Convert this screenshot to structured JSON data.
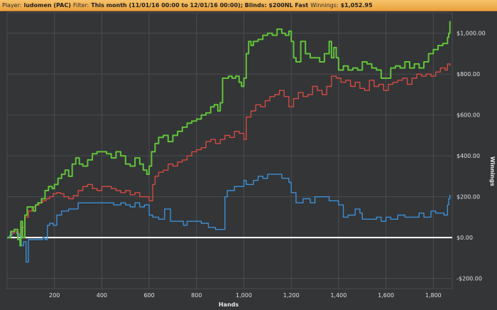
{
  "header": {
    "player_label": "Player:",
    "player_value": "ludomen (PAC)",
    "filter_label": "Filter:",
    "filter_value": "This month (11/01/16 00:00 to 12/01/16 00:00); Blinds: $200NL Fast",
    "winnings_label": "Winnings:",
    "winnings_value": "$1,052.95"
  },
  "colors": {
    "background": "#333537",
    "grid": "#4a4d50",
    "zero_line": "#ffffff",
    "header": "#f0ad4e"
  },
  "chart_data": {
    "type": "line",
    "xlabel": "Hands",
    "ylabel": "Winnings",
    "xlim": [
      0,
      1880
    ],
    "ylim": [
      -250,
      1100
    ],
    "xticks": [
      200,
      400,
      600,
      800,
      1000,
      1200,
      1400,
      1600,
      1800
    ],
    "xtick_labels": [
      "200",
      "400",
      "600",
      "800",
      "1,000",
      "1,200",
      "1,400",
      "1,600",
      "1,800"
    ],
    "yticks": [
      -200,
      0,
      200,
      400,
      600,
      800,
      1000
    ],
    "ytick_labels": [
      "-$200.00",
      "$0.00",
      "$200.00",
      "$400.00",
      "$600.00",
      "$800.00",
      "$1,000.00"
    ],
    "grid": true,
    "series": [
      {
        "color": "#62c33a",
        "x": [
          0,
          15,
          30,
          45,
          55,
          58,
          65,
          75,
          85,
          100,
          110,
          120,
          130,
          145,
          160,
          175,
          190,
          200,
          215,
          230,
          245,
          260,
          275,
          290,
          305,
          320,
          340,
          360,
          380,
          400,
          420,
          440,
          460,
          480,
          500,
          520,
          540,
          560,
          575,
          590,
          600,
          610,
          625,
          640,
          660,
          680,
          700,
          720,
          740,
          760,
          780,
          800,
          820,
          840,
          860,
          875,
          890,
          900,
          910,
          920,
          935,
          950,
          965,
          980,
          990,
          1000,
          1010,
          1020,
          1030,
          1040,
          1060,
          1080,
          1100,
          1120,
          1140,
          1160,
          1175,
          1190,
          1200,
          1210,
          1220,
          1240,
          1260,
          1280,
          1300,
          1320,
          1340,
          1350,
          1360,
          1370,
          1380,
          1390,
          1400,
          1420,
          1440,
          1460,
          1480,
          1500,
          1520,
          1540,
          1560,
          1580,
          1600,
          1620,
          1640,
          1660,
          1680,
          1700,
          1720,
          1740,
          1760,
          1780,
          1800,
          1820,
          1840,
          1850,
          1860,
          1865,
          1870
        ],
        "y": [
          0,
          30,
          40,
          -10,
          -40,
          80,
          0,
          110,
          150,
          150,
          130,
          160,
          170,
          190,
          230,
          250,
          240,
          260,
          290,
          310,
          330,
          300,
          360,
          390,
          360,
          350,
          380,
          410,
          420,
          420,
          410,
          390,
          420,
          400,
          360,
          350,
          390,
          360,
          330,
          310,
          350,
          420,
          460,
          490,
          500,
          470,
          500,
          520,
          540,
          560,
          570,
          580,
          600,
          610,
          640,
          650,
          620,
          660,
          780,
          780,
          790,
          780,
          790,
          760,
          740,
          780,
          900,
          960,
          940,
          960,
          970,
          990,
          1000,
          990,
          1020,
          1000,
          990,
          1010,
          960,
          880,
          860,
          960,
          900,
          880,
          880,
          860,
          900,
          900,
          960,
          880,
          930,
          880,
          820,
          840,
          820,
          830,
          820,
          860,
          850,
          830,
          820,
          780,
          780,
          830,
          840,
          830,
          860,
          830,
          850,
          830,
          860,
          900,
          920,
          940,
          950,
          950,
          980,
          1000,
          1060
        ]
      },
      {
        "color": "#d54a40",
        "x": [
          0,
          15,
          30,
          45,
          60,
          75,
          90,
          105,
          120,
          135,
          150,
          165,
          180,
          195,
          210,
          225,
          240,
          260,
          280,
          300,
          320,
          340,
          360,
          380,
          400,
          420,
          440,
          460,
          480,
          500,
          520,
          540,
          560,
          580,
          600,
          615,
          625,
          640,
          660,
          680,
          700,
          720,
          740,
          760,
          780,
          800,
          820,
          840,
          860,
          880,
          900,
          920,
          940,
          960,
          980,
          1000,
          1010,
          1030,
          1050,
          1070,
          1090,
          1110,
          1130,
          1150,
          1170,
          1190,
          1210,
          1230,
          1250,
          1270,
          1290,
          1310,
          1330,
          1350,
          1370,
          1390,
          1410,
          1430,
          1450,
          1470,
          1490,
          1510,
          1530,
          1550,
          1570,
          1590,
          1610,
          1630,
          1650,
          1670,
          1690,
          1710,
          1730,
          1750,
          1770,
          1790,
          1810,
          1830,
          1850,
          1860,
          1870
        ],
        "y": [
          0,
          20,
          30,
          20,
          50,
          100,
          130,
          150,
          160,
          170,
          180,
          190,
          200,
          215,
          220,
          215,
          200,
          190,
          205,
          230,
          250,
          260,
          240,
          230,
          250,
          250,
          240,
          230,
          220,
          230,
          210,
          220,
          200,
          200,
          180,
          260,
          300,
          320,
          330,
          360,
          350,
          370,
          380,
          400,
          420,
          430,
          440,
          470,
          480,
          460,
          480,
          500,
          490,
          520,
          510,
          480,
          590,
          620,
          650,
          640,
          670,
          690,
          700,
          720,
          690,
          640,
          680,
          710,
          690,
          700,
          740,
          720,
          700,
          740,
          790,
          780,
          760,
          770,
          740,
          760,
          730,
          720,
          770,
          740,
          750,
          720,
          750,
          760,
          770,
          780,
          750,
          780,
          800,
          790,
          800,
          790,
          810,
          830,
          820,
          850,
          840
        ]
      },
      {
        "color": "#3d8fd6",
        "x": [
          0,
          10,
          20,
          30,
          40,
          50,
          60,
          70,
          80,
          90,
          100,
          110,
          120,
          135,
          150,
          160,
          170,
          180,
          195,
          210,
          230,
          260,
          300,
          350,
          400,
          450,
          480,
          500,
          520,
          540,
          560,
          580,
          600,
          615,
          640,
          665,
          690,
          720,
          745,
          760,
          790,
          820,
          850,
          880,
          910,
          920,
          930,
          960,
          1000,
          1010,
          1040,
          1060,
          1080,
          1100,
          1130,
          1160,
          1190,
          1200,
          1220,
          1250,
          1280,
          1300,
          1330,
          1360,
          1400,
          1420,
          1440,
          1470,
          1490,
          1500,
          1530,
          1560,
          1580,
          1600,
          1620,
          1650,
          1680,
          1710,
          1740,
          1760,
          1790,
          1810,
          1830,
          1845,
          1860,
          1865,
          1870
        ],
        "y": [
          0,
          10,
          30,
          30,
          20,
          10,
          -40,
          -20,
          -120,
          -10,
          -10,
          -10,
          -10,
          -10,
          0,
          -10,
          60,
          70,
          60,
          110,
          130,
          140,
          170,
          170,
          170,
          160,
          170,
          160,
          150,
          170,
          150,
          160,
          110,
          100,
          90,
          140,
          80,
          80,
          60,
          80,
          80,
          70,
          50,
          40,
          40,
          200,
          230,
          250,
          280,
          260,
          280,
          300,
          290,
          310,
          310,
          290,
          270,
          220,
          170,
          190,
          170,
          200,
          200,
          180,
          160,
          100,
          110,
          140,
          120,
          90,
          90,
          100,
          80,
          100,
          90,
          110,
          100,
          100,
          120,
          100,
          130,
          120,
          120,
          110,
          160,
          190,
          210
        ]
      }
    ]
  }
}
